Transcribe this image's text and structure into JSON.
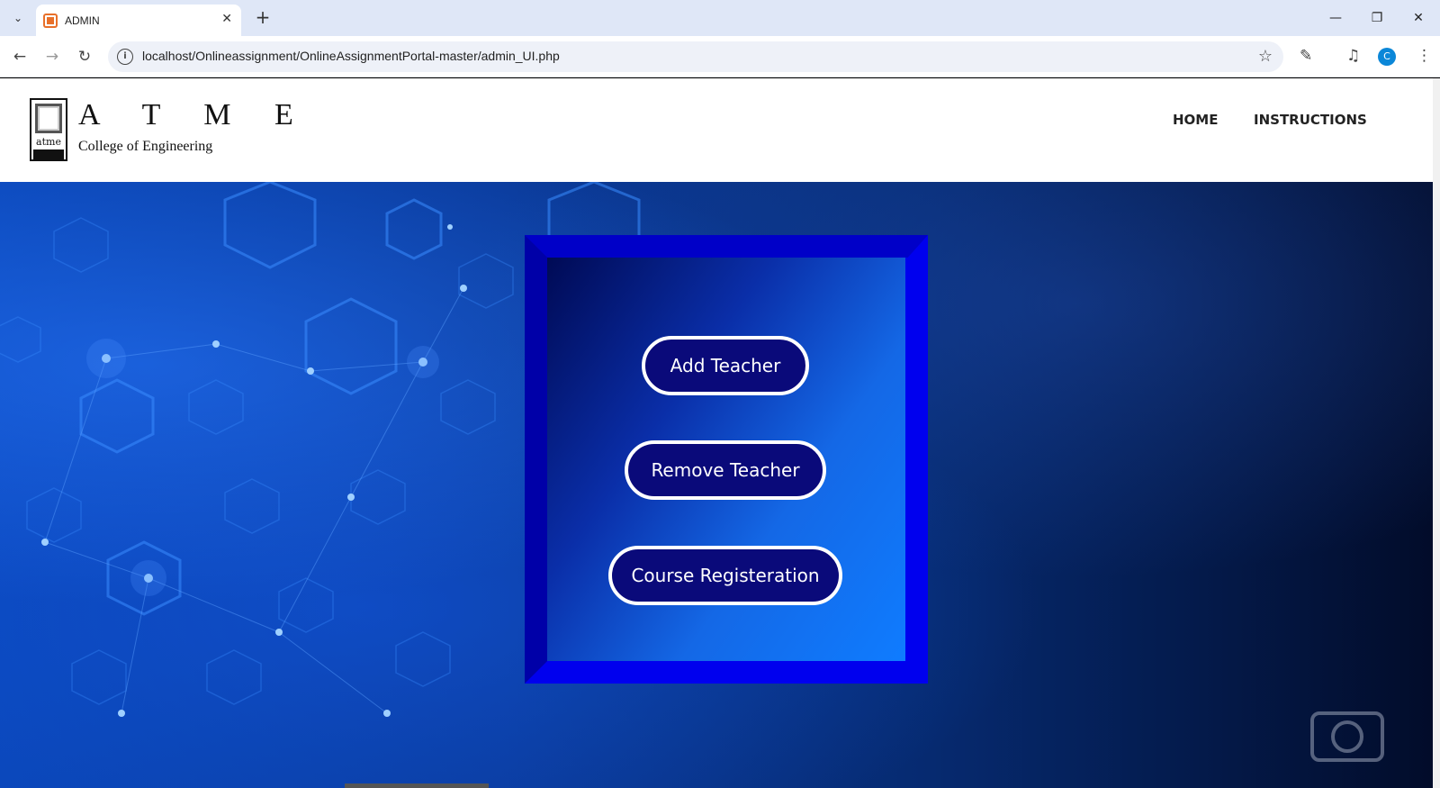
{
  "browser": {
    "tab_title": "ADMIN",
    "new_tab": "+",
    "url": "localhost/Onlineassignment/OnlineAssignmentPortal-master/admin_UI.php",
    "profile_initial": "C"
  },
  "header": {
    "logo_title": "A T M E",
    "logo_subtitle": "College of Engineering",
    "logo_badge": "atme",
    "nav": [
      {
        "label": "HOME"
      },
      {
        "label": "INSTRUCTIONS"
      }
    ]
  },
  "panel": {
    "buttons": [
      {
        "label": "Add Teacher"
      },
      {
        "label": "Remove Teacher"
      },
      {
        "label": "Course Registeration"
      }
    ]
  },
  "colors": {
    "panel_frame": "#0000ee",
    "button_fill": "#0a0a7a",
    "button_border": "#ffffff"
  }
}
